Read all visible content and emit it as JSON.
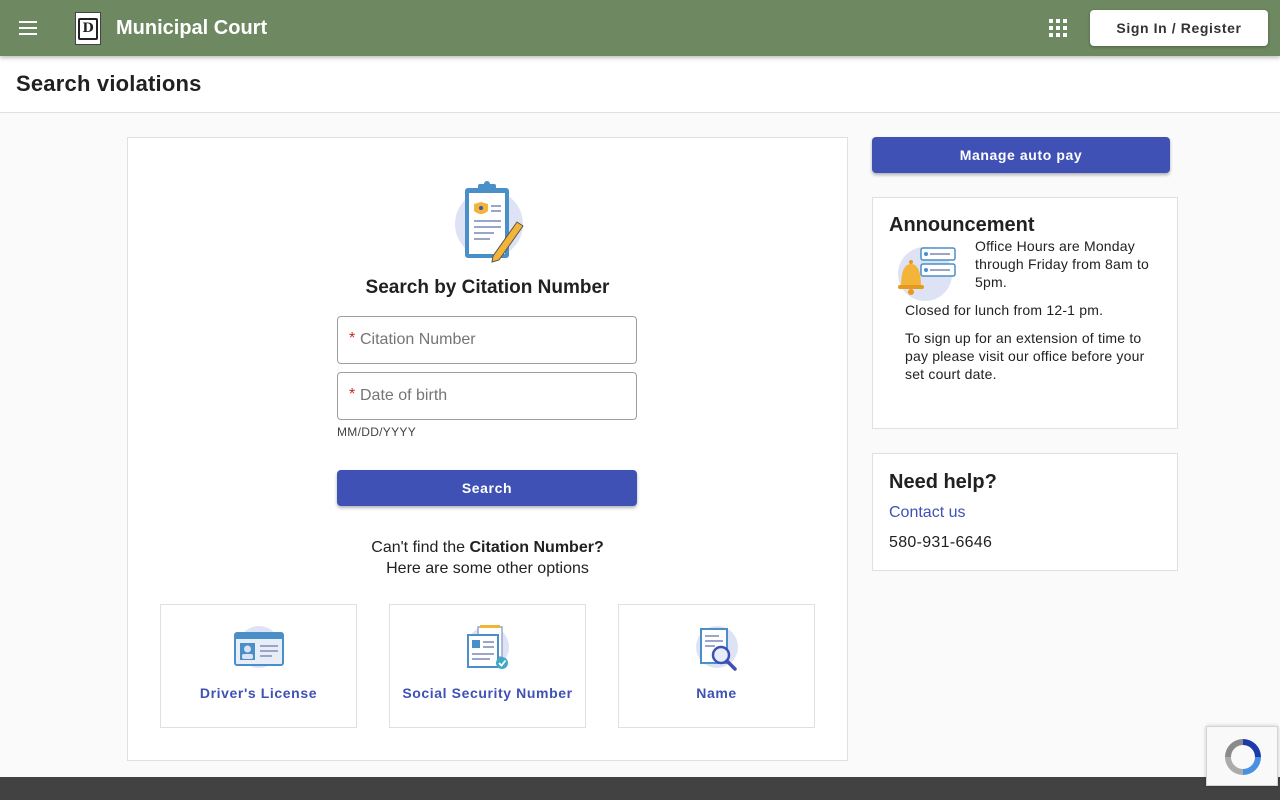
{
  "header": {
    "title": "Municipal Court",
    "signin_label": "Sign In / Register",
    "bg_color": "#6e8962"
  },
  "page": {
    "title": "Search violations"
  },
  "search": {
    "heading": "Search by Citation Number",
    "citation_placeholder": "Citation Number",
    "dob_placeholder": "Date of birth",
    "dob_hint": "MM/DD/YYYY",
    "required_mark": "*",
    "button_label": "Search",
    "cant_find_prefix": "Can't find the ",
    "cant_find_bold": "Citation Number?",
    "cant_find_line2": "Here are some other options"
  },
  "options": [
    {
      "label": "Driver's License",
      "icon": "id-card-icon"
    },
    {
      "label": "Social Security Number",
      "icon": "ssn-document-icon"
    },
    {
      "label": "Name",
      "icon": "name-search-icon"
    }
  ],
  "sidebar": {
    "autopay_label": "Manage auto pay",
    "announcement": {
      "title": "Announcement",
      "lines": [
        "Office Hours are Monday through Friday from 8am to 5pm.",
        "Closed for lunch from 12-1 pm.",
        "To sign up for an extension of time to pay please visit our office before your set court date."
      ]
    },
    "help": {
      "title": "Need help?",
      "contact_label": "Contact us",
      "phone": "580-931-6646"
    }
  },
  "colors": {
    "primary": "#3f51b5",
    "required": "#c62828"
  }
}
